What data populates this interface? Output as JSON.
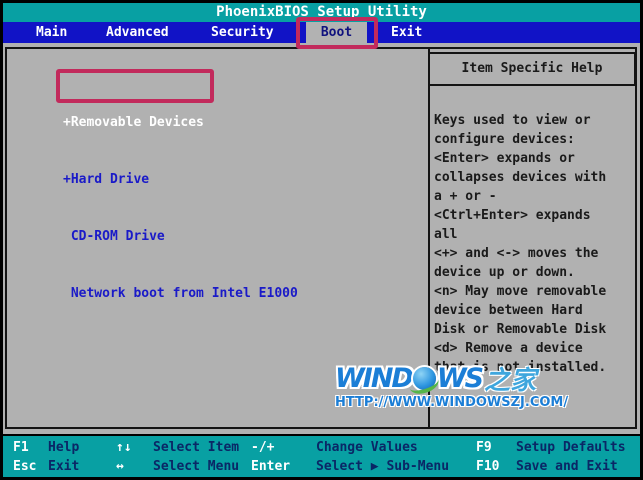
{
  "title": "PhoenixBIOS Setup Utility",
  "menu": {
    "items": [
      {
        "label": "Main",
        "selected": false
      },
      {
        "label": "Advanced",
        "selected": false
      },
      {
        "label": "Security",
        "selected": false
      },
      {
        "label": "Boot",
        "selected": true
      },
      {
        "label": "Exit",
        "selected": false
      }
    ]
  },
  "boot": {
    "items": [
      {
        "label": "+Removable Devices",
        "selected": true
      },
      {
        "label": "+Hard Drive",
        "selected": false
      },
      {
        "label": " CD-ROM Drive",
        "selected": false
      },
      {
        "label": " Network boot from Intel E1000",
        "selected": false
      }
    ]
  },
  "help": {
    "title": "Item Specific Help",
    "body": "Keys used to view or\nconfigure devices:\n<Enter> expands or\ncollapses devices with\na + or -\n<Ctrl+Enter> expands\nall\n<+> and <-> moves the\ndevice up or down.\n<n> May move removable\ndevice between Hard\nDisk or Removable Disk\n<d> Remove a device\nthat is not installed."
  },
  "footer": {
    "rows": [
      {
        "entries": [
          {
            "key": "F1",
            "label": "Help"
          },
          {
            "key": "↑↓",
            "label": "Select Item"
          },
          {
            "key": "-/+",
            "label": "Change Values"
          },
          {
            "key": "F9",
            "label": "Setup Defaults"
          }
        ]
      },
      {
        "entries": [
          {
            "key": "Esc",
            "label": "Exit"
          },
          {
            "key": "↔",
            "label": "Select Menu"
          },
          {
            "key": "Enter",
            "label": "Select ▶ Sub-Menu"
          },
          {
            "key": "F10",
            "label": "Save and Exit"
          }
        ]
      }
    ]
  },
  "watermark": {
    "logo_prefix": "WIND",
    "logo_suffix": "WS",
    "logo_cn": "之家",
    "url": "HTTP://WWW.WINDOWSZJ.COM/"
  },
  "colors": {
    "teal_bar": "#08a0a3",
    "menu_blue": "#1113c6",
    "content_gray": "#b1b1b1",
    "item_blue": "#1a1ac8",
    "selected_item_white": "#ffffff",
    "footer_label_navy": "#0a2766",
    "highlight_red": "#c22a5c",
    "watermark_blue": "#1b7ed6"
  }
}
